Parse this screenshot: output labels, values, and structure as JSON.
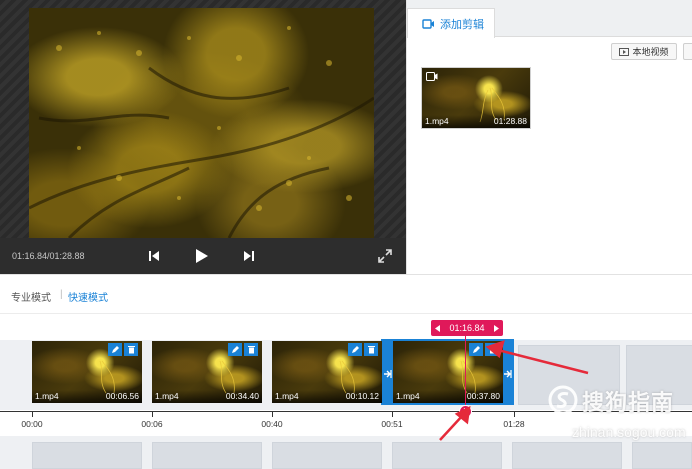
{
  "player": {
    "time_readout": "01:16.84/01:28.88"
  },
  "right_panel": {
    "tab_label": "添加剪辑",
    "local_video_label": "本地视频",
    "library": [
      {
        "name": "1.mp4",
        "duration": "01:28.88"
      }
    ]
  },
  "modes": {
    "pro_label": "专业模式",
    "separator": "|",
    "fast_label": "快速模式"
  },
  "timeline": {
    "clips": [
      {
        "name": "1.mp4",
        "duration": "00:06.56"
      },
      {
        "name": "1.mp4",
        "duration": "00:34.40"
      },
      {
        "name": "1.mp4",
        "duration": "00:10.12"
      },
      {
        "name": "1.mp4",
        "duration": "00:37.80",
        "selected": true
      }
    ],
    "ruler": [
      "00:00",
      "00:06",
      "00:40",
      "00:51",
      "01:28"
    ],
    "playhead_time": "01:16.84"
  },
  "watermark": {
    "brand": "搜狗指南",
    "url": "zhinan.sogou.com"
  },
  "colors": {
    "accent_blue": "#1a82d6",
    "playhead_red": "#e0195a",
    "player_bg": "#2d2d2d"
  }
}
